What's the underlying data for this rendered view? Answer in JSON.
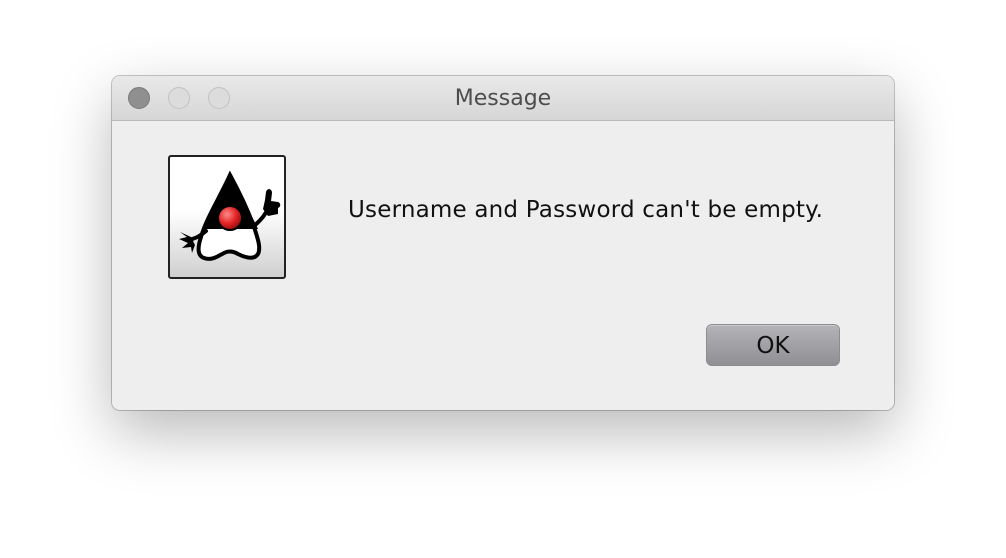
{
  "dialog": {
    "title": "Message",
    "message": "Username and Password can't be empty.",
    "ok_label": "OK",
    "icon": "java-duke-icon"
  },
  "window_controls": {
    "close": "close-icon",
    "minimize": "minimize-icon",
    "zoom": "zoom-icon"
  },
  "colors": {
    "dialog_background": "#eeeeee",
    "titlebar": "#dcdcdc",
    "button": "#9f9fa3",
    "duke_nose": "#d91c1c"
  }
}
